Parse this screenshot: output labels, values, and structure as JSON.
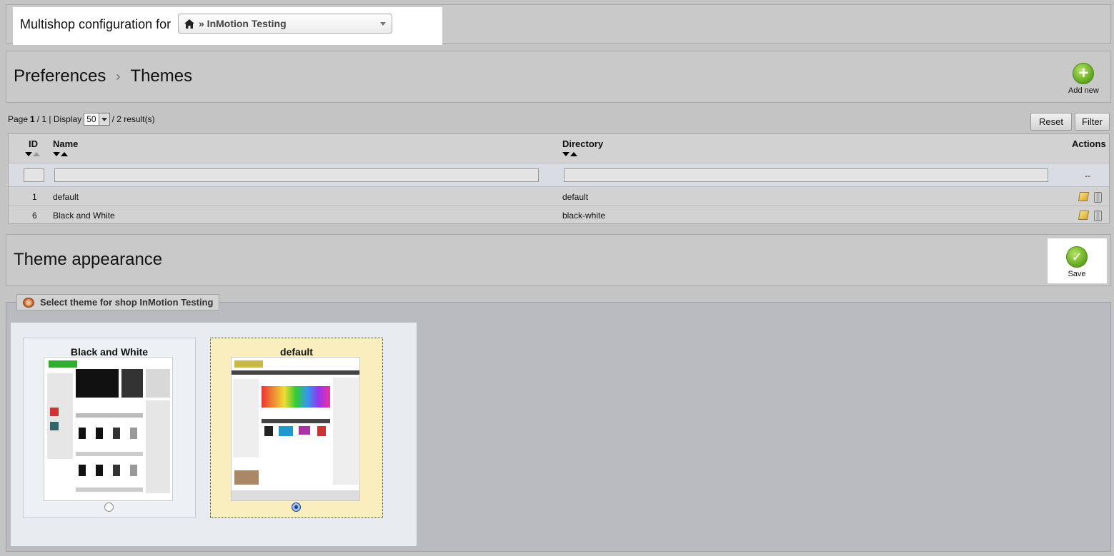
{
  "multishop": {
    "label": "Multishop configuration for",
    "selected_shop": "» InMotion Testing",
    "shop_icon": "home-icon"
  },
  "breadcrumb": {
    "parent": "Preferences",
    "separator": "›",
    "current": "Themes"
  },
  "toolbar": {
    "add_new_label": "Add new",
    "add_new_icon": "plus-icon"
  },
  "pagination": {
    "page_prefix": "Page",
    "page_current": "1",
    "page_total_text": "/ 1 | Display",
    "per_page": "50",
    "results_text": "/ 2 result(s)"
  },
  "list_buttons": {
    "reset": "Reset",
    "filter": "Filter"
  },
  "table": {
    "columns": {
      "id": "ID",
      "name": "Name",
      "directory": "Directory",
      "actions": "Actions"
    },
    "filter_actions_placeholder": "--",
    "rows": [
      {
        "id": "1",
        "name": "default",
        "directory": "default"
      },
      {
        "id": "6",
        "name": "Black and White",
        "directory": "black-white"
      }
    ]
  },
  "appearance": {
    "title": "Theme appearance",
    "save_label": "Save",
    "save_icon": "check-icon"
  },
  "theme_select": {
    "legend": "Select theme for shop InMotion Testing",
    "legend_icon": "palette-icon",
    "themes": [
      {
        "name": "Black and White",
        "selected": false
      },
      {
        "name": "default",
        "selected": true
      }
    ]
  },
  "colors": {
    "background": "#c4c4c4",
    "selected_card": "#fbeebe",
    "accent_green": "#5ea51a"
  }
}
